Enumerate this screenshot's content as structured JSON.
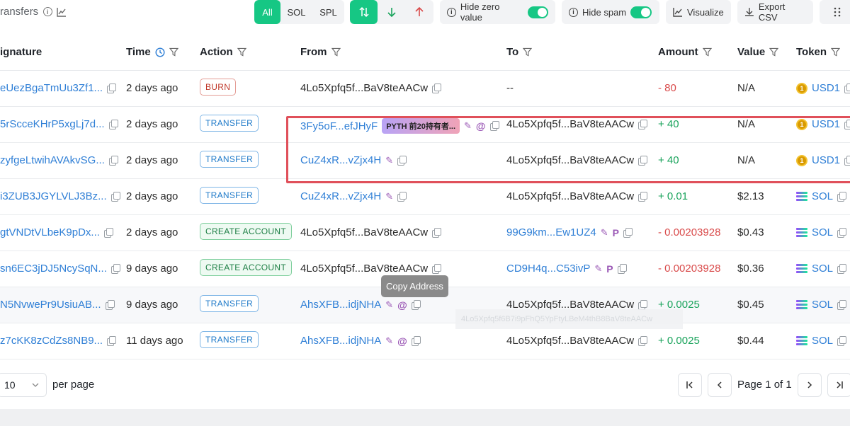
{
  "toolbar": {
    "title": "ransfers",
    "filters": [
      "All",
      "SOL",
      "SPL"
    ],
    "active_filter": "All",
    "direction_buttons": [
      "both-arrows-icon",
      "arrow-down-icon",
      "arrow-up-icon"
    ],
    "hide_zero_label": "Hide zero value",
    "hide_spam_label": "Hide spam",
    "visualize_label": "Visualize",
    "export_label": "Export CSV"
  },
  "columns": {
    "signature": "ignature",
    "time": "Time",
    "action": "Action",
    "from": "From",
    "to": "To",
    "amount": "Amount",
    "value": "Value",
    "token": "Token"
  },
  "rows": [
    {
      "signature": "eUezBgaTmUu3Zf1...",
      "time": "2 days ago",
      "action": "BURN",
      "action_type": "burn",
      "from": "4Lo5Xpfq5f...BaV8teAACw",
      "from_link": false,
      "to": "--",
      "to_link": false,
      "amount": "- 80",
      "amount_sign": "neg",
      "value": "N/A",
      "token": "USD1",
      "token_icon": "usd1-coin-icon"
    },
    {
      "signature": "5rScceKHrP5xgLj7d...",
      "time": "2 days ago",
      "action": "TRANSFER",
      "action_type": "transfer",
      "from": "3Fy5oF...efJHyF",
      "from_link": true,
      "from_tag": "PYTH 前20持有者...",
      "to": "4Lo5Xpfq5f...BaV8teAACw",
      "to_link": false,
      "amount": "+ 40",
      "amount_sign": "pos",
      "value": "N/A",
      "token": "USD1",
      "token_icon": "usd1-coin-icon"
    },
    {
      "signature": "zyfgeLtwihAVAkvSG...",
      "time": "2 days ago",
      "action": "TRANSFER",
      "action_type": "transfer",
      "from": "CuZ4xR...vZjx4H",
      "from_link": true,
      "to": "4Lo5Xpfq5f...BaV8teAACw",
      "to_link": false,
      "amount": "+ 40",
      "amount_sign": "pos",
      "value": "N/A",
      "token": "USD1",
      "token_icon": "usd1-coin-icon"
    },
    {
      "signature": "i3ZUB3JGYLVLJ3Bz...",
      "time": "2 days ago",
      "action": "TRANSFER",
      "action_type": "transfer",
      "from": "CuZ4xR...vZjx4H",
      "from_link": true,
      "to": "4Lo5Xpfq5f...BaV8teAACw",
      "to_link": false,
      "amount": "+ 0.01",
      "amount_sign": "pos",
      "value": "$2.13",
      "token": "SOL",
      "token_icon": "sol-icon"
    },
    {
      "signature": "gtVNDtVLbeK9pDx...",
      "time": "2 days ago",
      "action": "CREATE ACCOUNT",
      "action_type": "create",
      "from": "4Lo5Xpfq5f...BaV8teAACw",
      "from_link": false,
      "to": "99G9km...Ew1UZ4",
      "to_link": true,
      "amount": "- 0.00203928",
      "amount_sign": "neg",
      "value": "$0.43",
      "token": "SOL",
      "token_icon": "sol-icon"
    },
    {
      "signature": "sn6EC3jDJ5NcySqN...",
      "time": "9 days ago",
      "action": "CREATE ACCOUNT",
      "action_type": "create",
      "from": "4Lo5Xpfq5f...BaV8teAACw",
      "from_link": false,
      "to": "CD9H4q...C53ivP",
      "to_link": true,
      "amount": "- 0.00203928",
      "amount_sign": "neg",
      "value": "$0.36",
      "token": "SOL",
      "token_icon": "sol-icon"
    },
    {
      "signature": "N5NvwePr9UsiuAB...",
      "time": "9 days ago",
      "action": "TRANSFER",
      "action_type": "transfer",
      "from": "AhsXFB...idjNHA",
      "from_link": true,
      "to": "4Lo5Xpfq5f...BaV8teAACw",
      "to_link": false,
      "amount": "+ 0.0025",
      "amount_sign": "pos",
      "value": "$0.45",
      "token": "SOL",
      "token_icon": "sol-icon"
    },
    {
      "signature": "z7cKK8zCdZs8NB9...",
      "time": "11 days ago",
      "action": "TRANSFER",
      "action_type": "transfer",
      "from": "AhsXFB...idjNHA",
      "from_link": true,
      "to": "4Lo5Xpfq5f...BaV8teAACw",
      "to_link": false,
      "amount": "+ 0.0025",
      "amount_sign": "pos",
      "value": "$0.44",
      "token": "SOL",
      "token_icon": "sol-icon"
    }
  ],
  "tooltip": "Copy Address",
  "ghost_address": "4Lo5Xpfq5f6B7i9pFhQ5YpFtyLBeM4thB8BaV8teAACw",
  "footer": {
    "per_page_value": "10",
    "per_page_label": "per page",
    "page_label": "Page 1 of 1"
  },
  "colors": {
    "accent": "#16c784",
    "link": "#2f7fd6",
    "negative": "#d94a4a",
    "positive": "#19a35b",
    "highlight_box": "#e0505a"
  }
}
